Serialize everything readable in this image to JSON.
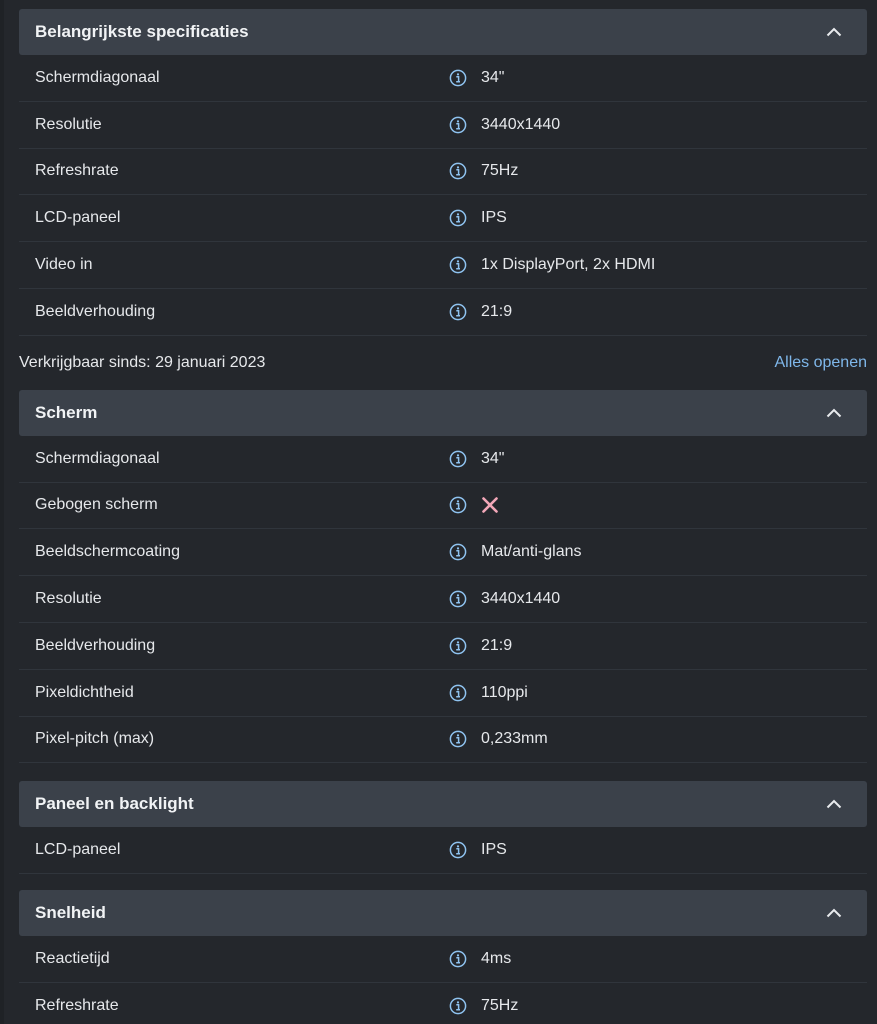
{
  "colors": {
    "background": "#24272c",
    "header_bg": "#3b414a",
    "info_icon": "#8fc3f0",
    "cross_icon": "#f2a7b8",
    "link": "#7fb7ea"
  },
  "sections": [
    {
      "title": "Belangrijkste specificaties",
      "rows": [
        {
          "label": "Schermdiagonaal",
          "value": "34\""
        },
        {
          "label": "Resolutie",
          "value": "3440x1440"
        },
        {
          "label": "Refreshrate",
          "value": "75Hz"
        },
        {
          "label": "LCD-paneel",
          "value": "IPS"
        },
        {
          "label": "Video in",
          "value": "1x DisplayPort, 2x HDMI"
        },
        {
          "label": "Beeldverhouding",
          "value": "21:9"
        }
      ]
    },
    {
      "title": "Scherm",
      "rows": [
        {
          "label": "Schermdiagonaal",
          "value": "34\""
        },
        {
          "label": "Gebogen scherm",
          "value": "",
          "icon": "cross-icon"
        },
        {
          "label": "Beeldschermcoating",
          "value": "Mat/anti-glans"
        },
        {
          "label": "Resolutie",
          "value": "3440x1440"
        },
        {
          "label": "Beeldverhouding",
          "value": "21:9"
        },
        {
          "label": "Pixeldichtheid",
          "value": "110ppi"
        },
        {
          "label": "Pixel-pitch (max)",
          "value": "0,233mm"
        }
      ]
    },
    {
      "title": "Paneel en backlight",
      "rows": [
        {
          "label": "LCD-paneel",
          "value": "IPS"
        }
      ]
    },
    {
      "title": "Snelheid",
      "rows": [
        {
          "label": "Reactietijd",
          "value": "4ms"
        },
        {
          "label": "Refreshrate",
          "value": "75Hz"
        }
      ]
    }
  ],
  "meta": {
    "available_since": "Verkrijgbaar sinds: 29 januari 2023",
    "open_all": "Alles openen"
  }
}
